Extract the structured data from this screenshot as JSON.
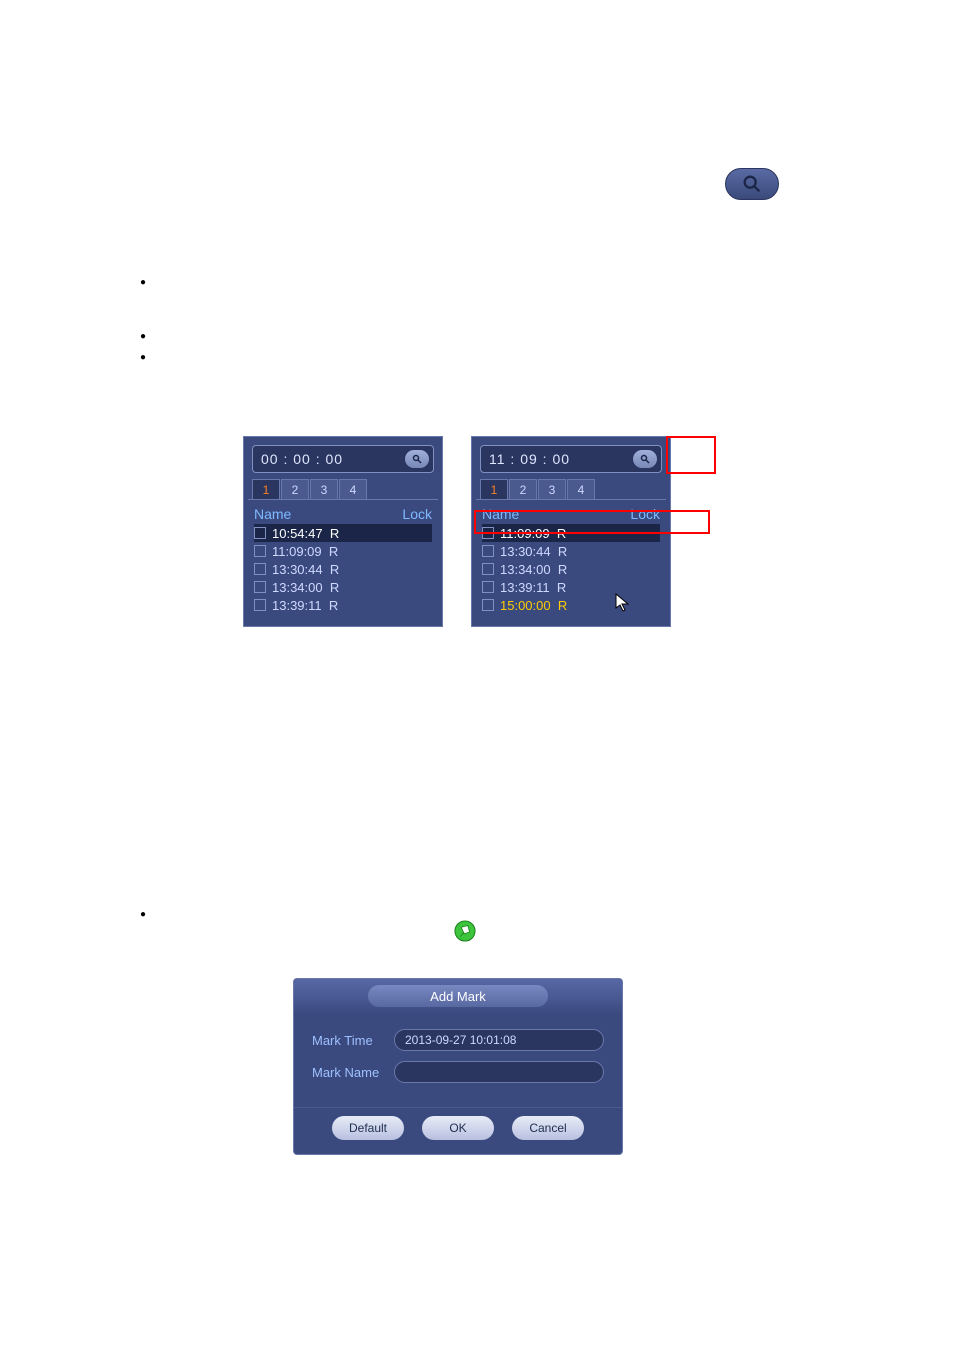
{
  "magnify_button": "search-icon",
  "panel1": {
    "time": "00 : 00 : 00",
    "tabs": [
      "1",
      "2",
      "3",
      "4"
    ],
    "active_tab": 0,
    "header_name": "Name",
    "header_lock": "Lock",
    "files": [
      {
        "time": "10:54:47",
        "type": "R",
        "highlight": true
      },
      {
        "time": "11:09:09",
        "type": "R"
      },
      {
        "time": "13:30:44",
        "type": "R"
      },
      {
        "time": "13:34:00",
        "type": "R"
      },
      {
        "time": "13:39:11",
        "type": "R"
      }
    ]
  },
  "panel2": {
    "time": "11 : 09 : 00",
    "tabs": [
      "1",
      "2",
      "3",
      "4"
    ],
    "active_tab": 0,
    "header_name": "Name",
    "header_lock": "Lock",
    "files": [
      {
        "time": "11:09:09",
        "type": "R",
        "highlight": true
      },
      {
        "time": "13:30:44",
        "type": "R"
      },
      {
        "time": "13:34:00",
        "type": "R"
      },
      {
        "time": "13:39:11",
        "type": "R"
      },
      {
        "time": "15:00:00",
        "type": "R",
        "yellow": true
      }
    ]
  },
  "dialog": {
    "title": "Add Mark",
    "mark_time_label": "Mark Time",
    "mark_time_value": "2013-09-27 10:01:08",
    "mark_name_label": "Mark Name",
    "mark_name_value": "",
    "buttons": {
      "default": "Default",
      "ok": "OK",
      "cancel": "Cancel"
    }
  }
}
